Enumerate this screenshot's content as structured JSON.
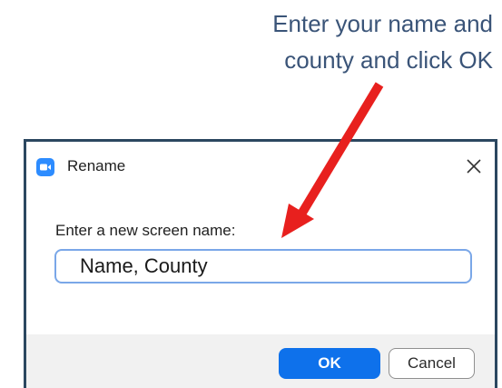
{
  "instruction": {
    "line1": "Enter your name and",
    "line2": "county and click OK"
  },
  "dialog": {
    "title": "Rename",
    "icon": "zoom-camera-icon",
    "close_icon": "close-icon",
    "prompt": "Enter a new screen name:",
    "input_value": "Name, County",
    "ok_label": "OK",
    "cancel_label": "Cancel"
  },
  "colors": {
    "instruction_text": "#3a5478",
    "dialog_border": "#2b4760",
    "app_icon": "#2d8cff",
    "ok_button": "#0e71eb",
    "input_border": "#7aa7e8",
    "arrow": "#e8201e"
  }
}
